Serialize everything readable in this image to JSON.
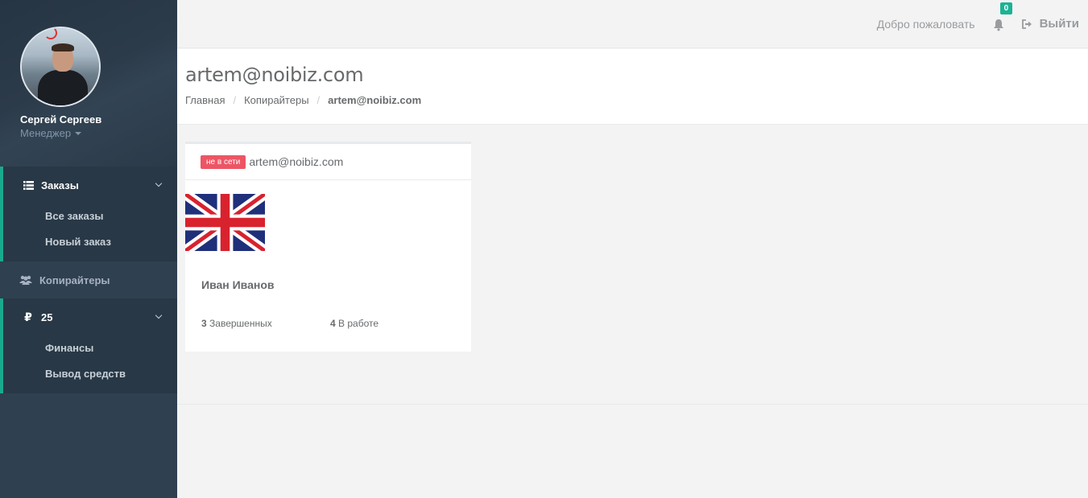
{
  "profile": {
    "name": "Сергей Сергеев",
    "role": "Менеджер"
  },
  "sidebar": {
    "orders": {
      "label": "Заказы",
      "items": [
        {
          "label": "Все заказы"
        },
        {
          "label": "Новый заказ"
        }
      ]
    },
    "copywriters": {
      "label": "Копирайтеры"
    },
    "balance": {
      "currency": "₽",
      "label": "25",
      "items": [
        {
          "label": "Финансы"
        },
        {
          "label": "Вывод средств"
        }
      ]
    }
  },
  "topbar": {
    "welcome": "Добро пожаловать",
    "notifications_count": "0",
    "logout_label": "Выйти"
  },
  "heading": {
    "title": "artem@noibiz.com",
    "breadcrumbs": [
      "Главная",
      "Копирайтеры",
      "artem@noibiz.com"
    ]
  },
  "card": {
    "status": "не в сети",
    "email": "artem@noibiz.com",
    "flag_icon": "uk-flag-icon",
    "person_name": "Иван Иванов",
    "completed_count": "3",
    "completed_label": "Завершенных",
    "in_progress_count": "4",
    "in_progress_label": "В работе"
  },
  "colors": {
    "sidebar": "#2f4050",
    "accent": "#19aa8d",
    "badge_green": "#1ab394",
    "badge_red": "#ed5565"
  }
}
